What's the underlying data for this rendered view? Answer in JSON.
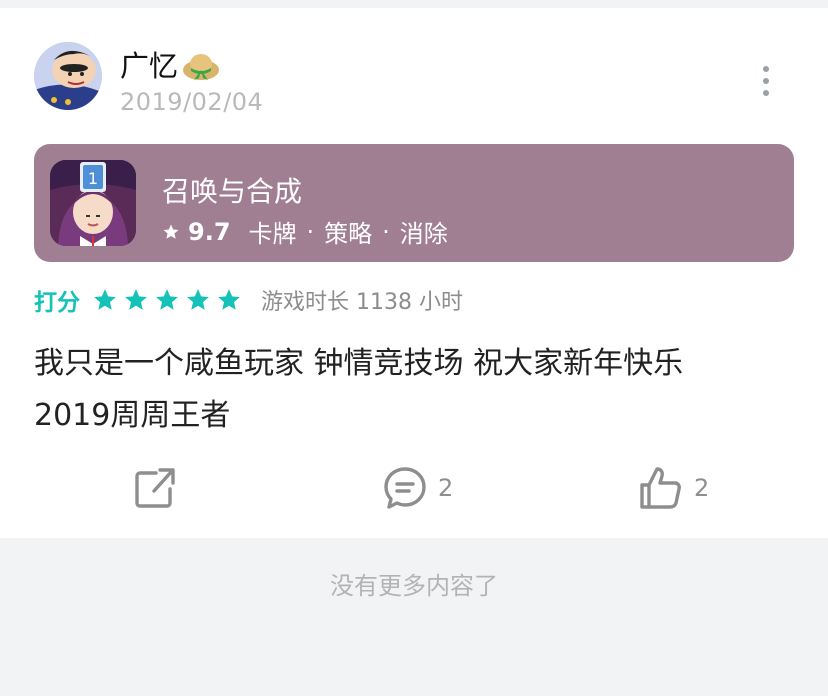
{
  "post": {
    "username": "广忆",
    "date": "2019/02/04"
  },
  "game": {
    "title": "召唤与合成",
    "rating": "9.7",
    "tags": [
      "卡牌",
      "策略",
      "消除"
    ]
  },
  "review": {
    "rating_label": "打分",
    "stars": 5,
    "playtime": "游戏时长 1138 小时",
    "text_line1": "我只是一个咸鱼玩家 钟情竞技场  祝大家新年快乐",
    "text_line2": "2019周周王者"
  },
  "actions": {
    "comment_count": "2",
    "like_count": "2"
  },
  "footer": {
    "no_more": "没有更多内容了"
  },
  "colors": {
    "accent": "#14c2b8",
    "game_card_bg": "#a17f92",
    "page_bg": "#f2f3f5"
  }
}
